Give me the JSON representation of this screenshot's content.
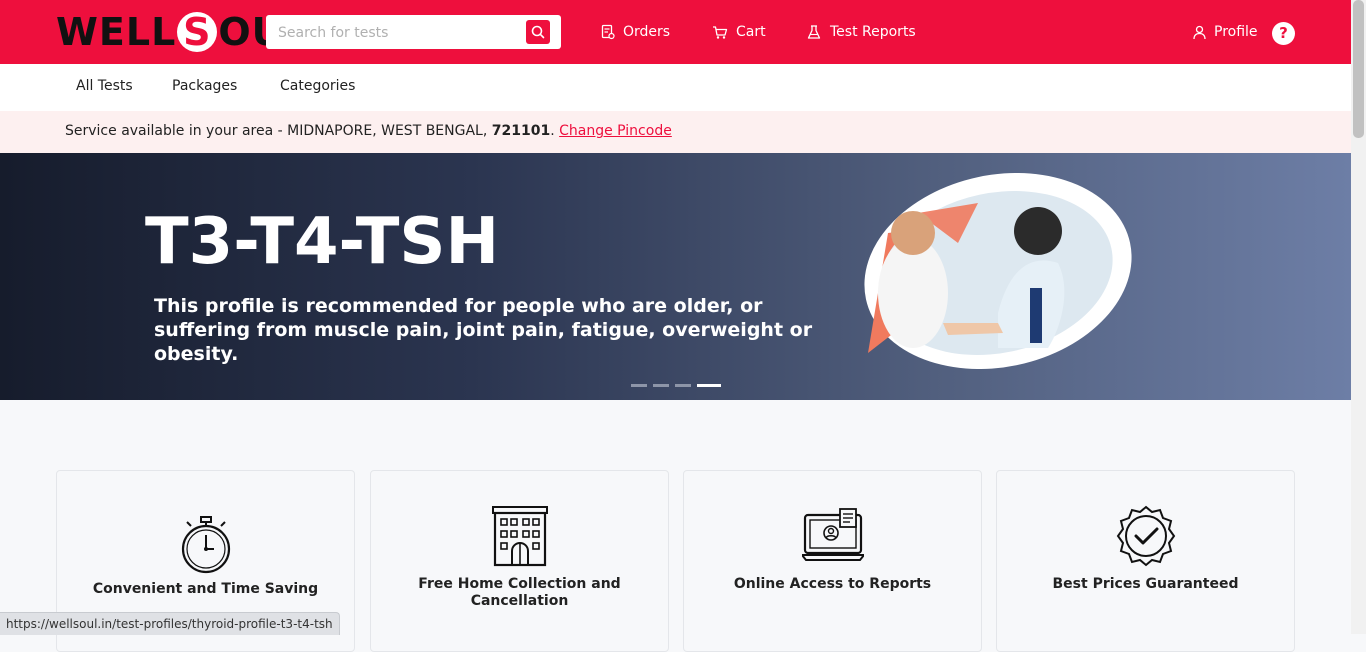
{
  "header": {
    "logo_text": "WELLSOUL",
    "search_placeholder": "Search for tests",
    "nav": {
      "orders": "Orders",
      "cart": "Cart",
      "test_reports": "Test Reports",
      "profile": "Profile",
      "help": "?"
    }
  },
  "subnav": {
    "items": [
      "All Tests",
      "Packages",
      "Categories"
    ]
  },
  "service": {
    "prefix": "Service available in your area - MIDNAPORE, WEST BENGAL, ",
    "pincode": "721101",
    "separator": ".",
    "change_link": "Change Pincode"
  },
  "banner": {
    "title": "T3-T4-TSH",
    "subtitle_line1": "This profile is recommended for people who are older, or",
    "subtitle_line2": "suffering from muscle pain, joint pain, fatigue, overweight or obesity.",
    "slide_count": 4,
    "active_slide": 4
  },
  "features": [
    {
      "title": "Convenient and Time Saving",
      "icon": "stopwatch-icon"
    },
    {
      "title": "Free Home Collection and Cancellation",
      "icon": "building-icon"
    },
    {
      "title": "Online Access to Reports",
      "icon": "report-monitor-icon"
    },
    {
      "title": "Best Prices Guaranteed",
      "icon": "badge-check-icon"
    }
  ],
  "status_url": "https://wellsoul.in/test-profiles/thyroid-profile-t3-t4-tsh",
  "colors": {
    "brand": "#ee0f3d",
    "banner_dark": "#161c2c",
    "service_bg": "#fdf0f0"
  }
}
